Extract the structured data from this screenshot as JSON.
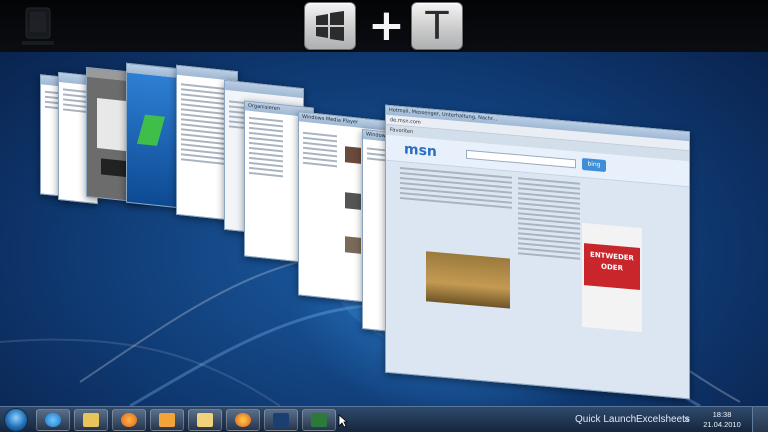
{
  "overlay": {
    "key_win": "windows-logo-key",
    "plus": "+",
    "key_t": "T"
  },
  "windows": {
    "msn": {
      "title": "Hotmail, Messenger, Unterhaltung, Nachr...",
      "address": "de.msn.com",
      "tab": "Favoriten",
      "brand": "msn",
      "search_button": "bing",
      "ad_line1": "ENTWEDER",
      "ad_line2": "ODER"
    },
    "media_player": {
      "title": "Windows Media Player"
    },
    "explorer": {
      "title": "Organisieren"
    },
    "browser2": {
      "title": "Windows Live"
    }
  },
  "taskbar": {
    "quick_launch": "Quick Launch",
    "excelsheets": "Excelsheets",
    "time": "18:38",
    "date": "21.04.2010",
    "chevron": "»"
  },
  "colors": {
    "accent": "#2a6ebd",
    "taskbar": "#1d3352",
    "desktop": "#1c5ca3"
  }
}
